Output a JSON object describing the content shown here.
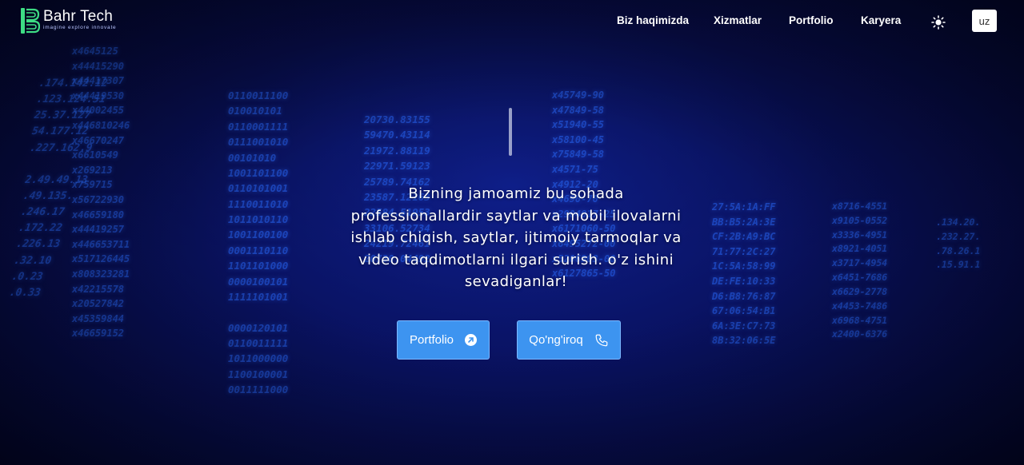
{
  "brand": {
    "name": "Bahr Tech",
    "tagline": "imagine explore innovate"
  },
  "nav": {
    "items": [
      "Biz haqimizda",
      "Xizmatlar",
      "Portfolio",
      "Karyera"
    ],
    "theme_icon": "sun-icon",
    "language": "uz"
  },
  "hero": {
    "text": "Bizning jamoamiz bu sohada professionallardir saytlar va mobil ilovalarni ishlab chiqish, saytlar, ijtimoiy tarmoqlar va video taqdimotlarni ilgari surish. o'z ishini sevadiganlar!",
    "buttons": {
      "portfolio_label": "Portfolio",
      "portfolio_icon": "arrow-up-right-icon",
      "call_label": "Qo'ng'iroq",
      "call_icon": "phone-icon"
    }
  },
  "colors": {
    "accent": "#3d94f0",
    "background": "#0a1670",
    "logo_green": "#3ddc84"
  }
}
